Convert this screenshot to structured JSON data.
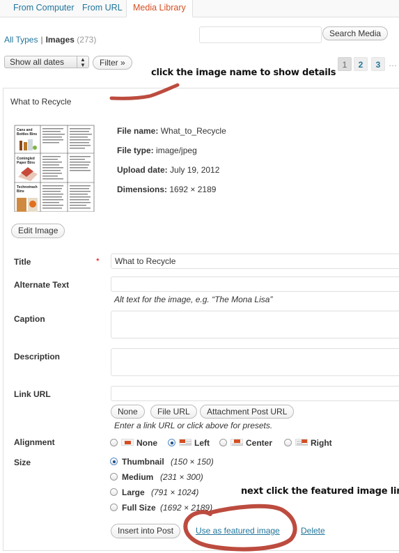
{
  "tabs": [
    {
      "label": "From Computer",
      "active": false
    },
    {
      "label": "From URL",
      "active": false
    },
    {
      "label": "Media Library",
      "active": true
    }
  ],
  "filters": {
    "all_types": "All Types",
    "separator": "|",
    "images": "Images",
    "images_count": "(273)",
    "search_placeholder": "",
    "search_button": "Search Media",
    "date_select": "Show all dates",
    "filter_button": "Filter »"
  },
  "pagination": {
    "pages": [
      "1",
      "2",
      "3"
    ],
    "current": "1",
    "ellipsis": "…"
  },
  "annotations": {
    "top": "click the image name to show details",
    "bottom": "next click the featured image link",
    "scribble_color": "#b5392a"
  },
  "item": {
    "title": "What to Recycle",
    "meta": {
      "file_name_label": "File name:",
      "file_name": "What_to_Recycle",
      "file_type_label": "File type:",
      "file_type": "image/jpeg",
      "upload_date_label": "Upload date:",
      "upload_date": "July 19, 2012",
      "dimensions_label": "Dimensions:",
      "dimensions": "1692 × 2189"
    },
    "edit_image_button": "Edit Image",
    "fields": {
      "title_label": "Title",
      "required_mark": "*",
      "title_value": "What to Recycle",
      "alt_label": "Alternate Text",
      "alt_value": "",
      "alt_help": "Alt text for the image, e.g. “The Mona Lisa”",
      "caption_label": "Caption",
      "caption_value": "",
      "description_label": "Description",
      "description_value": "",
      "link_label": "Link URL",
      "link_value": "",
      "link_buttons": [
        "None",
        "File URL",
        "Attachment Post URL"
      ],
      "link_help": "Enter a link URL or click above for presets."
    },
    "alignment": {
      "label": "Alignment",
      "options": [
        "None",
        "Left",
        "Center",
        "Right"
      ],
      "selected": "Left"
    },
    "size": {
      "label": "Size",
      "options": [
        {
          "name": "Thumbnail",
          "dims": "(150 × 150)"
        },
        {
          "name": "Medium",
          "dims": "(231 × 300)"
        },
        {
          "name": "Large",
          "dims": "(791 × 1024)"
        },
        {
          "name": "Full Size",
          "dims": "(1692 × 2189)"
        }
      ],
      "selected": "Thumbnail"
    },
    "actions": {
      "insert": "Insert into Post",
      "featured": "Use as featured image",
      "delete": "Delete"
    },
    "thumbnail_text": {
      "row1": "Cans and Bottles Bins",
      "row2": "Comingled Paper Bins",
      "row3": "Technotrash Bins"
    }
  },
  "colors": {
    "link": "#21759b",
    "active_tab": "#d54e21",
    "required": "#dd0000"
  }
}
